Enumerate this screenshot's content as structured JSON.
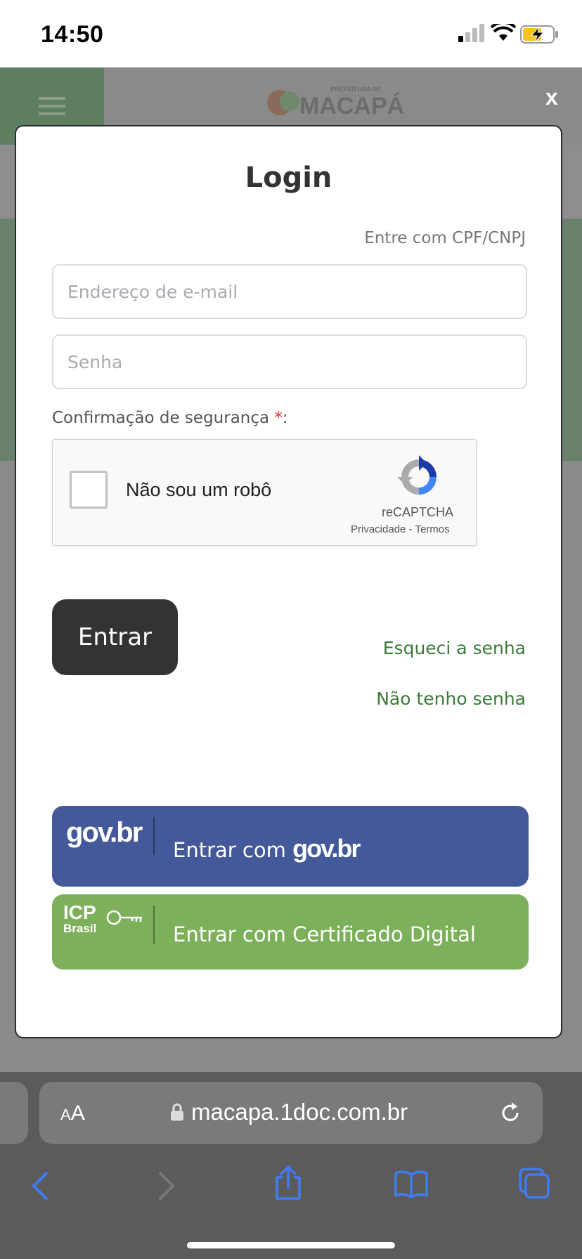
{
  "status_bar": {
    "time": "14:50"
  },
  "background_site": {
    "logo_top": "PREFEITURA DE",
    "logo_main": "MACAPÁ"
  },
  "modal": {
    "close_label": "x",
    "title": "Login",
    "cpf_link": "Entre com CPF/CNPJ",
    "email_placeholder": "Endereço de e-mail",
    "password_placeholder": "Senha",
    "security_label": "Confirmação de segurança ",
    "required_mark": "*",
    "security_suffix": ":",
    "recaptcha": {
      "label": "Não sou um robô",
      "brand": "reCAPTCHA",
      "privacy": "Privacidade",
      "separator": " - ",
      "terms": "Termos"
    },
    "submit_label": "Entrar",
    "forgot_link": "Esqueci a senha",
    "no_password_link": "Não tenho senha",
    "gov_button": {
      "logo": "gov.br",
      "text": "Entrar com ",
      "brand": "gov.br"
    },
    "icp_button": {
      "logo_top": "ICP",
      "logo_bottom": "Brasil",
      "text": "Entrar com Certificado Digital"
    }
  },
  "browser": {
    "text_size_small": "A",
    "text_size_large": "A",
    "url": "macapa.1doc.com.br"
  },
  "colors": {
    "gov_blue": "#44599a",
    "icp_green": "#7cb05a",
    "link_green": "#3c7a3c",
    "button_dark": "#333333",
    "toolbar_blue": "#3f7df2"
  }
}
